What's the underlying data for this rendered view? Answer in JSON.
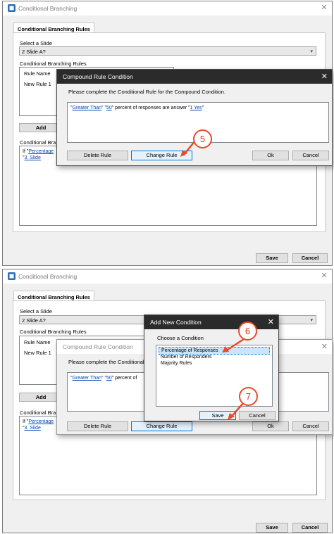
{
  "top": {
    "window_title": "Conditional Branching",
    "tab_label": "Conditional Branching Rules",
    "select_slide_label": "Select a Slide",
    "slide_value": "2 Slide A?",
    "rules_label": "Conditional Branching Rules",
    "rule_name_header": "Rule Name",
    "rule_item": "New Rule 1",
    "add_button": "Add",
    "rule_text_label": "Conditional Bra",
    "rule_text_prefix": "If \"",
    "rule_text_link1": "Percentage",
    "rule_text_link2": "3. Slide",
    "save_button": "Save",
    "cancel_button": "Cancel",
    "compound_dialog": {
      "title": "Compound Rule Condition",
      "instruction": "Please complete the Conditional Rule for the Compound Condition.",
      "rule_q1": "\"",
      "rule_link1": "Greater Than",
      "rule_q2": "\"  \"",
      "rule_link2": "50",
      "rule_mid": "\"  percent of responses are answer \"",
      "rule_link3": "1 Yes",
      "rule_q3": "\"",
      "delete_button": "Delete Rule",
      "change_button": "Change Rule",
      "ok_button": "Ok",
      "cancel_button": "Cancel"
    },
    "callout": "5"
  },
  "bottom": {
    "window_title": "Conditional Branching",
    "tab_label": "Conditional Branching Rules",
    "select_slide_label": "Select a Slide",
    "slide_value": "2 Slide A?",
    "rules_label": "Conditional Branching Rules",
    "rule_name_header": "Rule Name",
    "rule_item": "New Rule 1",
    "add_button": "Add",
    "rule_text_label": "Conditional Bra",
    "rule_text_prefix": "If \"",
    "rule_text_link1": "Percentage",
    "rule_text_link2": "3. Slide",
    "save_button": "Save",
    "cancel_button": "Cancel",
    "compound_dialog": {
      "title": "Compound Rule Condition",
      "instruction": "Please complete the Conditional",
      "rule_q1": "\"",
      "rule_link1": "Greater Than",
      "rule_q2": "\"  \"",
      "rule_link2": "50",
      "rule_mid": "\"  percent of",
      "delete_button": "Delete Rule",
      "change_button": "Change Rule",
      "ok_button": "Ok",
      "cancel_button": "Cancel"
    },
    "add_condition_dialog": {
      "title": "Add New Condition",
      "prompt": "Choose a Condition",
      "options": [
        "Percentage of Responses",
        "Number of Responders",
        "Majority Rules"
      ],
      "save_button": "Save",
      "cancel_button": "Cancel"
    },
    "callout_list": "6",
    "callout_save": "7"
  },
  "colors": {
    "accent": "#0078d7",
    "callout": "#e84a2a",
    "link": "#0645ad",
    "dark_title": "#2b2b2b"
  }
}
